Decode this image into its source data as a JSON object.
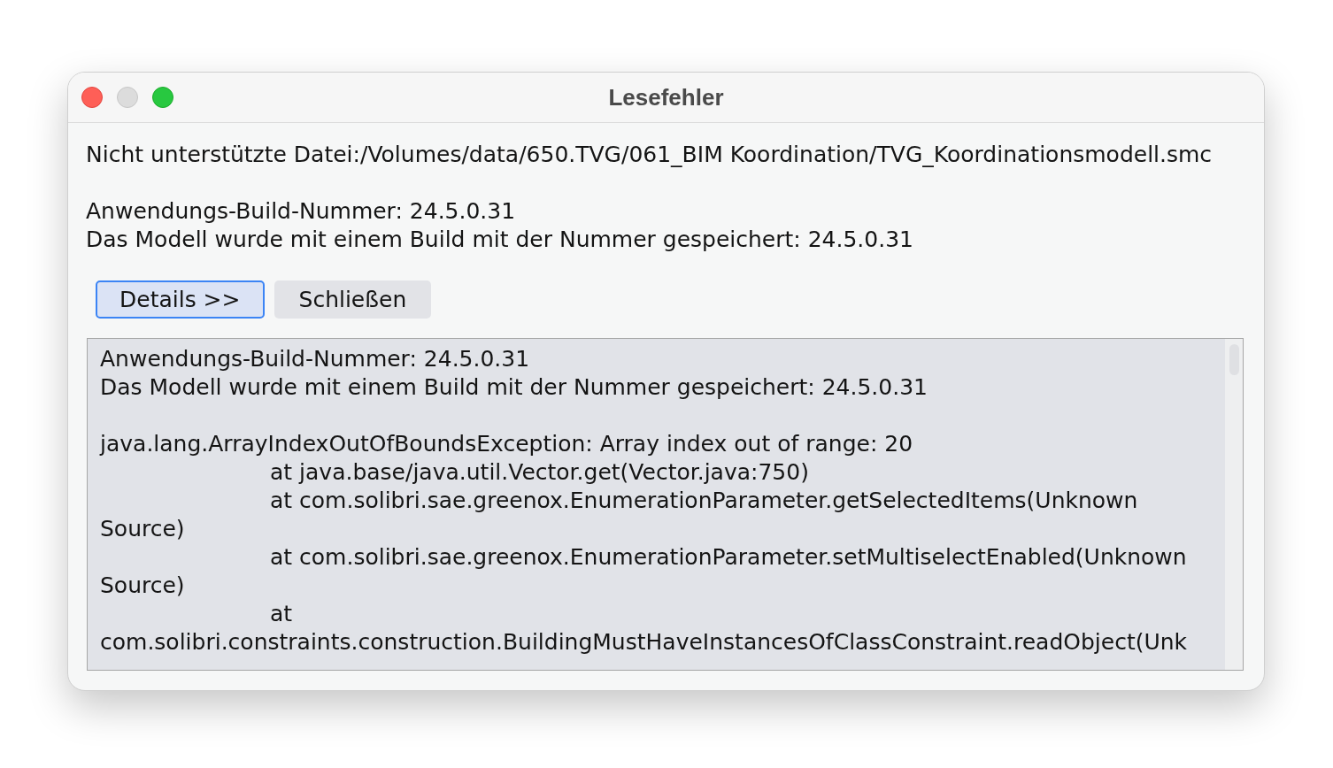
{
  "window": {
    "title": "Lesefehler",
    "controls": [
      {
        "kind": "close",
        "disabled": false
      },
      {
        "kind": "minimize",
        "disabled": true
      },
      {
        "kind": "zoom",
        "disabled": false
      }
    ]
  },
  "message": {
    "paragraphs": [
      [
        "Nicht unterstützte Datei:/Volumes/data/650.TVG/061_BIM Koordination/TVG_Koordinationsmodell.smc"
      ],
      [
        "Anwendungs-Build-Nummer: 24.5.0.31",
        "Das Modell wurde mit einem Build mit der Nummer gespeichert: 24.5.0.31"
      ]
    ]
  },
  "buttons": [
    {
      "label": "Details >>",
      "focused": true
    },
    {
      "label": "Schließen",
      "focused": false
    }
  ],
  "details": {
    "header_lines": [
      "Anwendungs-Build-Nummer: 24.5.0.31",
      "Das Modell wurde mit einem Build mit der Nummer gespeichert: 24.5.0.31"
    ],
    "exception": "java.lang.ArrayIndexOutOfBoundsException: Array index out of range: 20",
    "stack_frames": [
      {
        "line": "at java.base/java.util.Vector.get(Vector.java:750)"
      },
      {
        "line": "at com.solibri.sae.greenox.EnumerationParameter.getSelectedItems(Unknown",
        "continuation": "Source)"
      },
      {
        "line": "at com.solibri.sae.greenox.EnumerationParameter.setMultiselectEnabled(Unknown",
        "continuation": "Source)"
      },
      {
        "line": "at",
        "continuation": "com.solibri.constraints.construction.BuildingMustHaveInstancesOfClassConstraint.readObject(Unk"
      }
    ]
  }
}
